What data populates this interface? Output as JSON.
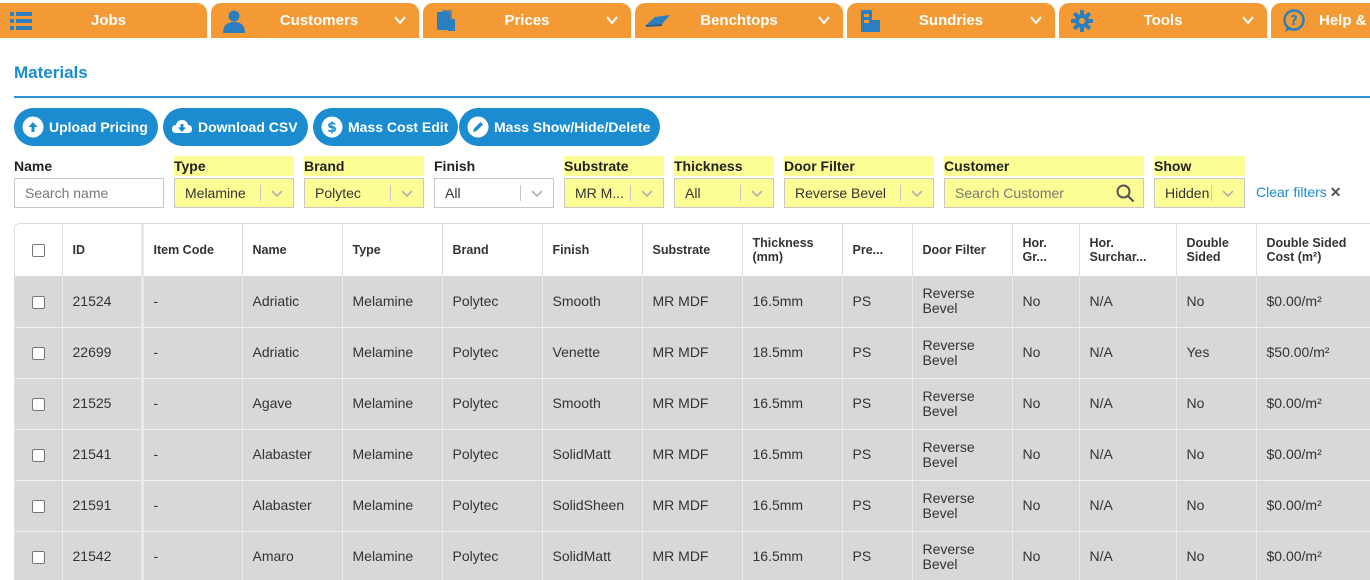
{
  "nav": {
    "tabs": [
      {
        "label": "Jobs",
        "icon": "list-icon",
        "has_dropdown": false
      },
      {
        "label": "Customers",
        "icon": "user-icon",
        "has_dropdown": true
      },
      {
        "label": "Prices",
        "icon": "price-sheet-icon",
        "has_dropdown": true
      },
      {
        "label": "Benchtops",
        "icon": "benchtop-icon",
        "has_dropdown": true
      },
      {
        "label": "Sundries",
        "icon": "sundries-icon",
        "has_dropdown": true
      },
      {
        "label": "Tools",
        "icon": "gear-icon",
        "has_dropdown": true
      },
      {
        "label": "Help &",
        "icon": "help-icon",
        "has_dropdown": false
      }
    ],
    "color": "#f39a34"
  },
  "page": {
    "title": "Materials",
    "accent": "#1a8ccf"
  },
  "actions": [
    {
      "label": "Upload Pricing",
      "icon": "cloud-upload-icon"
    },
    {
      "label": "Download CSV",
      "icon": "cloud-download-icon"
    },
    {
      "label": "Mass Cost Edit",
      "icon": "dollar-icon"
    },
    {
      "label": "Mass Show/Hide/Delete",
      "icon": "pencil-icon"
    }
  ],
  "filters": {
    "name": {
      "label": "Name",
      "placeholder": "Search name",
      "value": ""
    },
    "type": {
      "label": "Type",
      "value": "Melamine"
    },
    "brand": {
      "label": "Brand",
      "value": "Polytec"
    },
    "finish": {
      "label": "Finish",
      "value": "All"
    },
    "substrate": {
      "label": "Substrate",
      "value": "MR M..."
    },
    "thickness": {
      "label": "Thickness",
      "value": "All"
    },
    "door_filter": {
      "label": "Door Filter",
      "value": "Reverse Bevel"
    },
    "customer": {
      "label": "Customer",
      "placeholder": "Search Customer",
      "value": ""
    },
    "show": {
      "label": "Show",
      "value": "Hidden"
    },
    "clear_label": "Clear filters",
    "highlight_color": "#fdfd96"
  },
  "table": {
    "headers": [
      "ID",
      "Item Code",
      "Name",
      "Type",
      "Brand",
      "Finish",
      "Substrate",
      "Thickness (mm)",
      "Pre...",
      "Door Filter",
      "Hor. Gr...",
      "Hor. Surchar...",
      "Double Sided",
      "Double Sided Cost (m²)"
    ],
    "rows": [
      [
        "21524",
        "-",
        "Adriatic",
        "Melamine",
        "Polytec",
        "Smooth",
        "MR MDF",
        "16.5mm",
        "PS",
        "Reverse Bevel",
        "No",
        "N/A",
        "No",
        "$0.00/m²"
      ],
      [
        "22699",
        "-",
        "Adriatic",
        "Melamine",
        "Polytec",
        "Venette",
        "MR MDF",
        "18.5mm",
        "PS",
        "Reverse Bevel",
        "No",
        "N/A",
        "Yes",
        "$50.00/m²"
      ],
      [
        "21525",
        "-",
        "Agave",
        "Melamine",
        "Polytec",
        "Smooth",
        "MR MDF",
        "16.5mm",
        "PS",
        "Reverse Bevel",
        "No",
        "N/A",
        "No",
        "$0.00/m²"
      ],
      [
        "21541",
        "-",
        "Alabaster",
        "Melamine",
        "Polytec",
        "SolidMatt",
        "MR MDF",
        "16.5mm",
        "PS",
        "Reverse Bevel",
        "No",
        "N/A",
        "No",
        "$0.00/m²"
      ],
      [
        "21591",
        "-",
        "Alabaster",
        "Melamine",
        "Polytec",
        "SolidSheen",
        "MR MDF",
        "16.5mm",
        "PS",
        "Reverse Bevel",
        "No",
        "N/A",
        "No",
        "$0.00/m²"
      ],
      [
        "21542",
        "-",
        "Amaro",
        "Melamine",
        "Polytec",
        "SolidMatt",
        "MR MDF",
        "16.5mm",
        "PS",
        "Reverse Bevel",
        "No",
        "N/A",
        "No",
        "$0.00/m²"
      ]
    ]
  }
}
